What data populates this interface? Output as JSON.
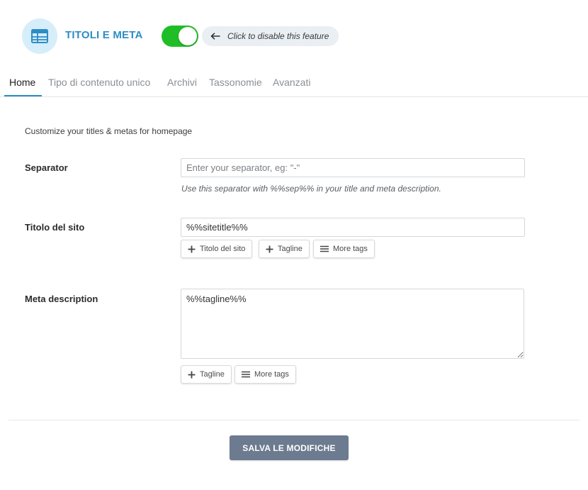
{
  "header": {
    "logo_icon": "table-icon",
    "title": "TITOLI E META",
    "toggle_on": true,
    "toggle_color": "#1fbe27",
    "hint_icon": "arrow-left-icon",
    "hint_text": "Click to disable this feature"
  },
  "tabs": [
    {
      "label": "Home",
      "active": true
    },
    {
      "label": "Tipo di contenuto unico",
      "active": false
    },
    {
      "label": "Archivi",
      "active": false
    },
    {
      "label": "Tassonomie",
      "active": false
    },
    {
      "label": "Avanzati",
      "active": false
    }
  ],
  "intro": "Customize your titles & metas for homepage",
  "fields": {
    "separator": {
      "label": "Separator",
      "value": "",
      "placeholder": "Enter your separator, eg: \"-\"",
      "help": "Use this separator with %%sep%% in your title and meta description."
    },
    "site_title": {
      "label": "Titolo del sito",
      "value": "%%sitetitle%%",
      "buttons": [
        {
          "label": "Titolo del sito",
          "icon": "plus-icon"
        },
        {
          "label": "Tagline",
          "icon": "plus-icon"
        },
        {
          "label": "More tags",
          "icon": "menu-icon"
        }
      ]
    },
    "meta_description": {
      "label": "Meta description",
      "value": "%%tagline%%",
      "buttons": [
        {
          "label": "Tagline",
          "icon": "plus-icon"
        },
        {
          "label": "More tags",
          "icon": "menu-icon"
        }
      ]
    }
  },
  "save_button": "SALVA LE MODIFICHE",
  "colors": {
    "accent": "#2e8dc5",
    "save_button": "#6c7b8f"
  }
}
